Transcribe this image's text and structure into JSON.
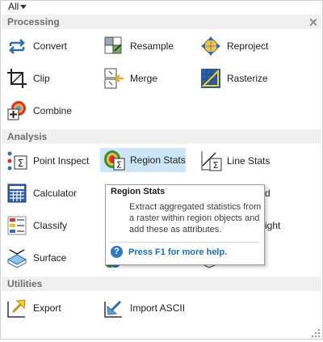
{
  "filter": {
    "value": "All"
  },
  "sections": {
    "processing": {
      "title": "Processing",
      "tools": {
        "convert": "Convert",
        "resample": "Resample",
        "reproject": "Reproject",
        "clip": "Clip",
        "merge": "Merge",
        "rasterize": "Rasterize",
        "combine": "Combine"
      }
    },
    "analysis": {
      "title": "Analysis",
      "tools": {
        "point_inspect": "Point Inspect",
        "region_stats": "Region Stats",
        "line_stats": "Line Stats",
        "calculator": "Calculator",
        "classify": "Classify",
        "surface": "Surface",
        "partial_right_1": "d",
        "partial_right_2": "ight"
      }
    },
    "utilities": {
      "title": "Utilities",
      "tools": {
        "export": "Export",
        "import_ascii": "Import ASCII"
      }
    }
  },
  "tooltip": {
    "title": "Region Stats",
    "body": "Extract aggregated statistics from a raster within region objects and add these as attributes.",
    "help": "Press F1 for more help."
  },
  "colors": {
    "section_header_bg": "#f0f0f0",
    "hover_bg": "#cde6f7",
    "icon_blue": "#2f6db5",
    "help_link": "#1b6fb8"
  }
}
